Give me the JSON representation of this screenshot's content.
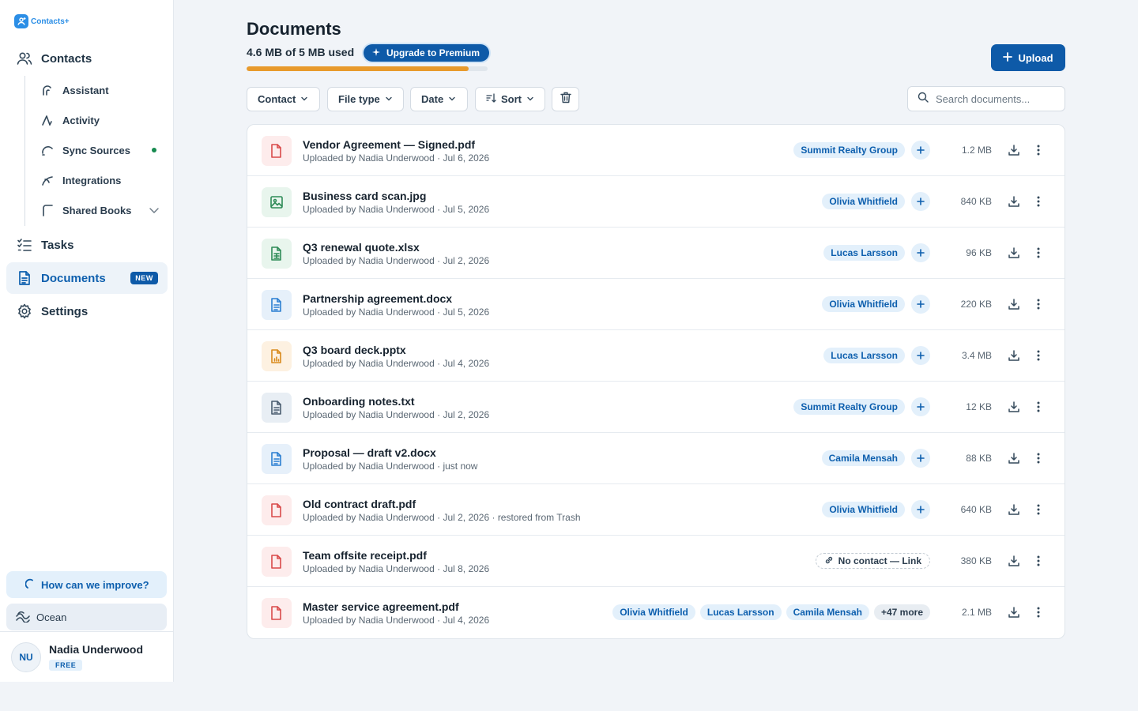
{
  "app": {
    "name": "Contacts+"
  },
  "sidebar": {
    "contacts": "Contacts",
    "sub_items": [
      {
        "label": "Assistant"
      },
      {
        "label": "Activity"
      },
      {
        "label": "Sync Sources",
        "status": "active"
      },
      {
        "label": "Integrations"
      },
      {
        "label": "Shared Books"
      }
    ],
    "tasks": "Tasks",
    "documents": "Documents",
    "documents_badge": "NEW",
    "settings": "Settings",
    "improve": "How can we improve?",
    "theme": "Ocean",
    "user": {
      "initials": "NU",
      "name": "Nadia Underwood",
      "plan": "FREE"
    }
  },
  "header": {
    "title": "Documents",
    "usage": "4.6 MB of 5 MB used",
    "usage_fraction": 0.92,
    "upgrade": "Upgrade to Premium",
    "upload": "Upload"
  },
  "filters": {
    "contact": "Contact",
    "file_type": "File type",
    "date": "Date",
    "sort": "Sort",
    "search_placeholder": "Search documents..."
  },
  "documents": [
    {
      "name": "Vendor Agreement — Signed.pdf",
      "meta": "Uploaded by Nadia Underwood · Jul 6, 2026",
      "type": "pdf",
      "contacts": [
        "Summit Realty Group"
      ],
      "size": "1.2 MB"
    },
    {
      "name": "Business card scan.jpg",
      "meta": "Uploaded by Nadia Underwood · Jul 5, 2026",
      "type": "img",
      "contacts": [
        "Olivia Whitfield"
      ],
      "size": "840 KB"
    },
    {
      "name": "Q3 renewal quote.xlsx",
      "meta": "Uploaded by Nadia Underwood · Jul 2, 2026",
      "type": "xls",
      "contacts": [
        "Lucas Larsson"
      ],
      "size": "96 KB"
    },
    {
      "name": "Partnership agreement.docx",
      "meta": "Uploaded by Nadia Underwood · Jul 5, 2026",
      "type": "doc",
      "contacts": [
        "Olivia Whitfield"
      ],
      "size": "220 KB"
    },
    {
      "name": "Q3 board deck.pptx",
      "meta": "Uploaded by Nadia Underwood · Jul 4, 2026",
      "type": "ppt",
      "contacts": [
        "Lucas Larsson"
      ],
      "size": "3.4 MB"
    },
    {
      "name": "Onboarding notes.txt",
      "meta": "Uploaded by Nadia Underwood · Jul 2, 2026",
      "type": "txt",
      "contacts": [
        "Summit Realty Group"
      ],
      "size": "12 KB"
    },
    {
      "name": "Proposal — draft v2.docx",
      "meta": "Uploaded by Nadia Underwood · just now",
      "type": "doc",
      "contacts": [
        "Camila Mensah"
      ],
      "size": "88 KB"
    },
    {
      "name": "Old contract draft.pdf",
      "meta": "Uploaded by Nadia Underwood · Jul 2, 2026 · restored from Trash",
      "type": "pdf",
      "contacts": [
        "Olivia Whitfield"
      ],
      "size": "640 KB"
    },
    {
      "name": "Team offsite receipt.pdf",
      "meta": "Uploaded by Nadia Underwood · Jul 8, 2026",
      "type": "pdf",
      "contacts": [],
      "no_contact": "No contact — Link",
      "size": "380 KB"
    },
    {
      "name": "Master service agreement.pdf",
      "meta": "Uploaded by Nadia Underwood · Jul 4, 2026",
      "type": "pdf",
      "contacts": [
        "Olivia Whitfield",
        "Lucas Larsson",
        "Camila Mensah"
      ],
      "more": "+47 more",
      "size": "2.1 MB"
    }
  ],
  "colors": {
    "brand": "#0e5aa8",
    "accent_light": "#e3f0fb",
    "progress": "#e89a2c",
    "status_dot": "#178a4f"
  }
}
